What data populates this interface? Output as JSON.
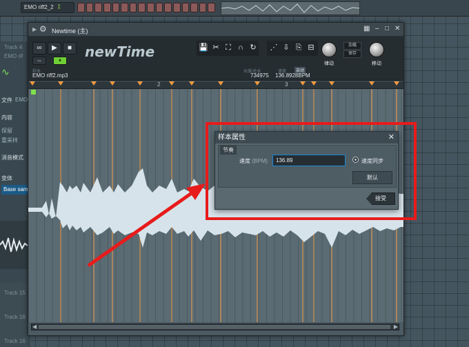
{
  "background": {
    "pattern_name": "EMO riff2_2",
    "left_panel": {
      "tracks_top": [
        "Track 4",
        "EMO rif"
      ],
      "items": [
        "文件",
        "EMO",
        "内容",
        "保留",
        "重采样",
        "消音模式",
        "变体"
      ],
      "selected_item": "Base sam",
      "tracks_bottom": [
        "Track 15",
        "Track 16",
        "Track 16"
      ]
    }
  },
  "window": {
    "title": "Newtime",
    "title_suffix": "(主)",
    "logo": "newTime",
    "file_label": "样本",
    "file_name": "EMO riff2.mp3",
    "length_label": "长度/总长",
    "length_value": "734975",
    "tempo_label": "速度",
    "tempo_tag": "自动",
    "tempo_value": "136.8928BPM",
    "knob1_label": "律动",
    "knob2_label": "移动",
    "load_label": "加载",
    "save_label": "保存",
    "ruler_marks": [
      "2",
      "3"
    ]
  },
  "dialog": {
    "title": "样本属性",
    "section": "节奏",
    "speed_label": "速度",
    "speed_unit": "(BPM)",
    "speed_value": "136.89",
    "sync_label": "速度同步",
    "default_button": "默认",
    "accept_button": "接受"
  },
  "colors": {
    "annotation_red": "#e81b1b",
    "marker_orange": "#f09a3e",
    "accent_green": "#7ee04a",
    "input_focus_blue": "#1a88d6"
  }
}
